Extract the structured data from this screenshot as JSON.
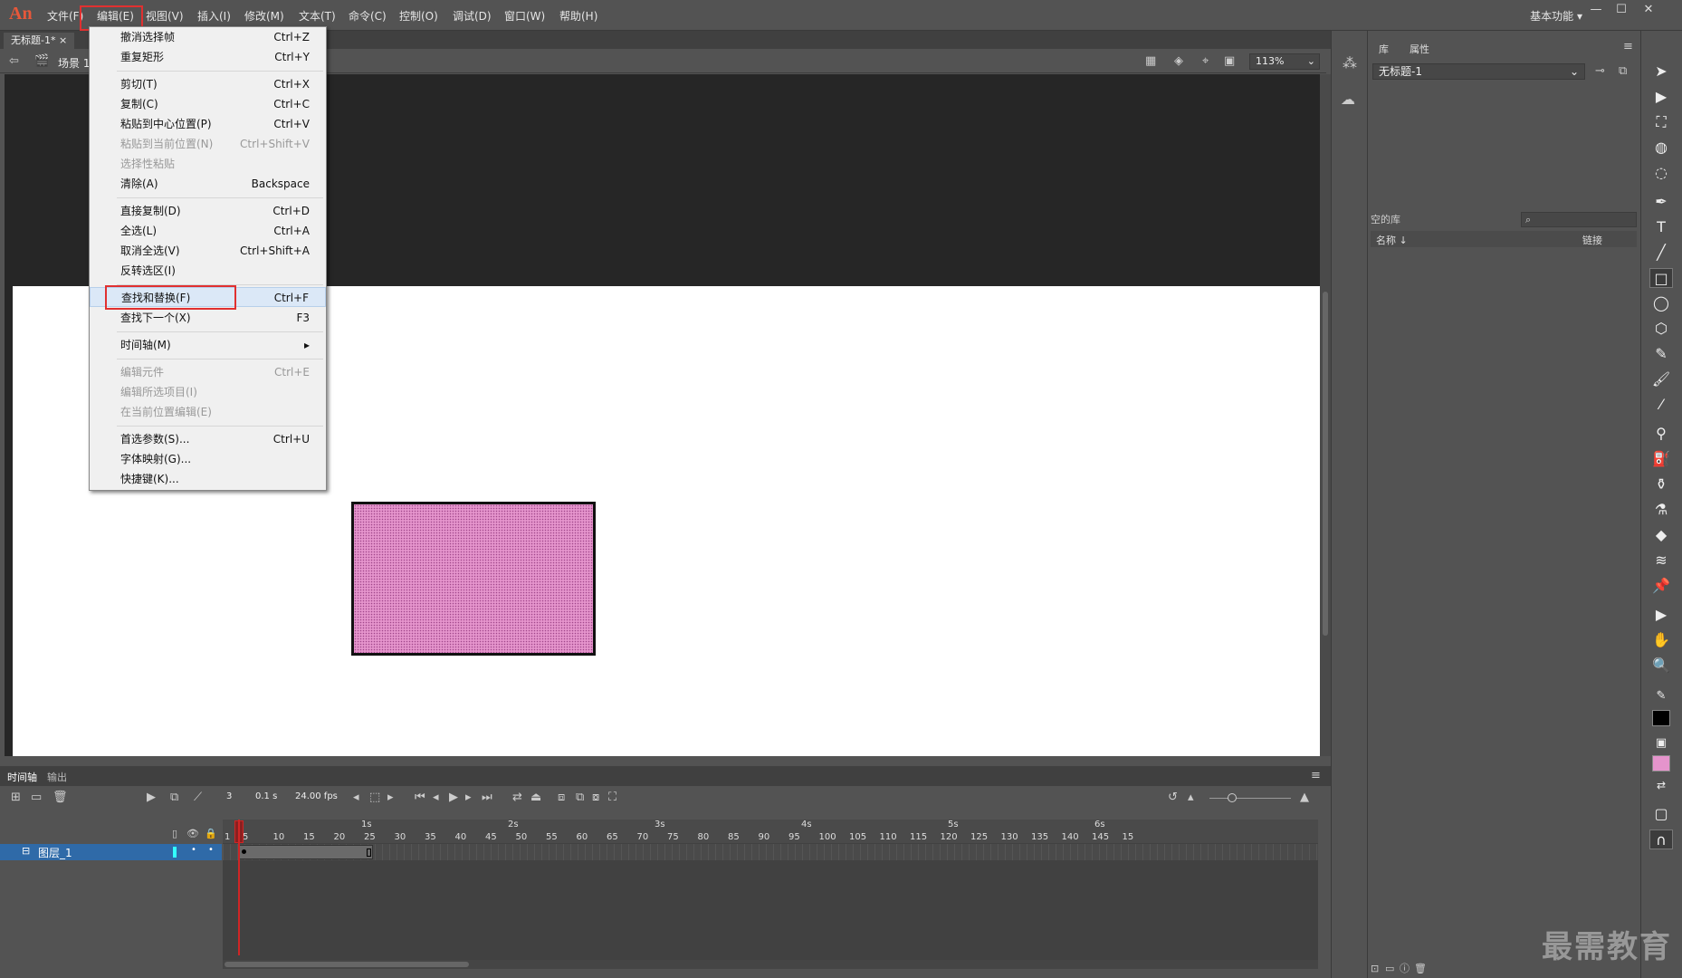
{
  "app": {
    "logo": "An",
    "workspace": "基本功能"
  },
  "menu": [
    "文件(F)",
    "编辑(E)",
    "视图(V)",
    "插入(I)",
    "修改(M)",
    "文本(T)",
    "命令(C)",
    "控制(O)",
    "调试(D)",
    "窗口(W)",
    "帮助(H)"
  ],
  "document": {
    "tab": "无标题-1*",
    "scene": "场景 1",
    "zoom": "113%"
  },
  "dropdown": [
    {
      "label": "撤消选择帧",
      "shortcut": "Ctrl+Z",
      "disabled": false
    },
    {
      "label": "重复矩形",
      "shortcut": "Ctrl+Y",
      "disabled": false
    },
    {
      "label": "剪切(T)",
      "shortcut": "Ctrl+X",
      "disabled": false
    },
    {
      "label": "复制(C)",
      "shortcut": "Ctrl+C",
      "disabled": false
    },
    {
      "label": "粘贴到中心位置(P)",
      "shortcut": "Ctrl+V",
      "disabled": false
    },
    {
      "label": "粘贴到当前位置(N)",
      "shortcut": "Ctrl+Shift+V",
      "disabled": true
    },
    {
      "label": "选择性粘贴",
      "shortcut": "",
      "disabled": true
    },
    {
      "label": "清除(A)",
      "shortcut": "Backspace",
      "disabled": false
    },
    {
      "label": "直接复制(D)",
      "shortcut": "Ctrl+D",
      "disabled": false
    },
    {
      "label": "全选(L)",
      "shortcut": "Ctrl+A",
      "disabled": false
    },
    {
      "label": "取消全选(V)",
      "shortcut": "Ctrl+Shift+A",
      "disabled": false
    },
    {
      "label": "反转选区(I)",
      "shortcut": "",
      "disabled": false
    },
    {
      "label": "查找和替换(F)",
      "shortcut": "Ctrl+F",
      "disabled": false
    },
    {
      "label": "查找下一个(X)",
      "shortcut": "F3",
      "disabled": false
    },
    {
      "label": "时间轴(M)",
      "shortcut": "▸",
      "disabled": false
    },
    {
      "label": "编辑元件",
      "shortcut": "Ctrl+E",
      "disabled": true
    },
    {
      "label": "编辑所选项目(I)",
      "shortcut": "",
      "disabled": true
    },
    {
      "label": "在当前位置编辑(E)",
      "shortcut": "",
      "disabled": true
    },
    {
      "label": "首选参数(S)...",
      "shortcut": "Ctrl+U",
      "disabled": false
    },
    {
      "label": "字体映射(G)...",
      "shortcut": "",
      "disabled": false
    },
    {
      "label": "快捷键(K)...",
      "shortcut": "",
      "disabled": false
    }
  ],
  "panels": {
    "tab_library": "库",
    "tab_properties": "属性",
    "library_doc": "无标题-1",
    "library_empty": "空的库",
    "col_name": "名称 ↓",
    "col_link": "链接"
  },
  "timeline": {
    "tab_timeline": "时间轴",
    "tab_output": "输出",
    "frame": "3",
    "time": "0.1 s",
    "fps": "24.00 fps",
    "layer": "图层_1",
    "ticks": [
      "1",
      "5",
      "10",
      "15",
      "20",
      "25",
      "30",
      "35",
      "40",
      "45",
      "50",
      "55",
      "60",
      "65",
      "70",
      "75",
      "80",
      "85",
      "90",
      "95",
      "100",
      "105",
      "110",
      "115",
      "120",
      "125",
      "130",
      "135",
      "140",
      "145",
      "15"
    ],
    "seconds": [
      "1s",
      "2s",
      "3s",
      "4s",
      "5s",
      "6s"
    ]
  },
  "watermark": "最需教育",
  "colors": {
    "fill": "#e594cc",
    "stroke": "#000000",
    "highlight": "#e03030"
  }
}
